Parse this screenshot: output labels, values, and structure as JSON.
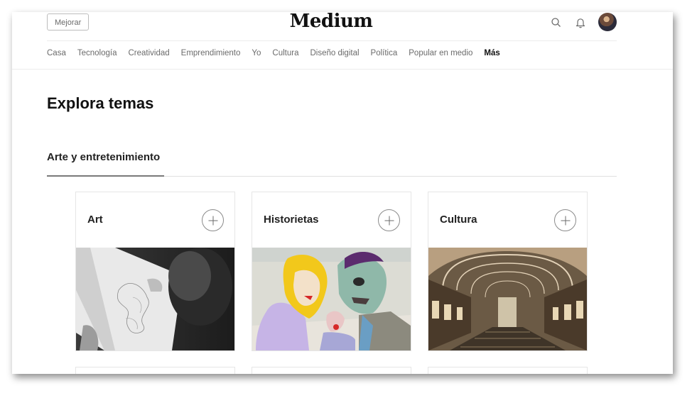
{
  "header": {
    "upgrade_label": "Mejorar",
    "logo": "Medium",
    "icons": [
      "search-icon",
      "bell-icon",
      "avatar"
    ]
  },
  "nav": {
    "items": [
      "Casa",
      "Tecnología",
      "Creatividad",
      "Emprendimiento",
      "Yo",
      "Cultura",
      "Diseño digital",
      "Política",
      "Popular en medio",
      "Más"
    ]
  },
  "main": {
    "title": "Explora temas",
    "section_tab": "Arte y entretenimiento",
    "topics": [
      {
        "label": "Art",
        "image": "sketching-photo"
      },
      {
        "label": "Historietas",
        "image": "comic-art"
      },
      {
        "label": "Cultura",
        "image": "library-hall-photo"
      }
    ]
  },
  "colors": {
    "text": "#1a1a1a",
    "muted": "#6b6b6b",
    "border": "#e6e6e6"
  }
}
